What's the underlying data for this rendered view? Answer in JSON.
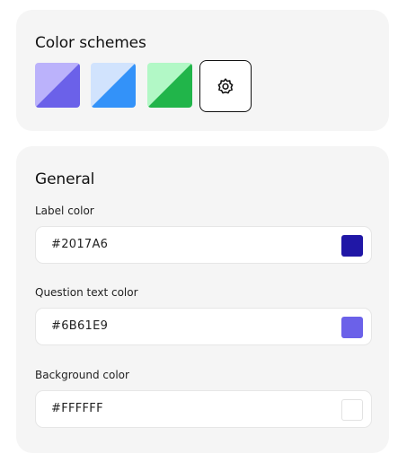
{
  "color_schemes": {
    "title": "Color schemes",
    "swatches": [
      {
        "name": "purple",
        "light": "#bbb2fb",
        "dark": "#6b61e9"
      },
      {
        "name": "blue",
        "light": "#d1e3fd",
        "dark": "#3392f9"
      },
      {
        "name": "green",
        "light": "#b2f8c6",
        "dark": "#21b54a"
      }
    ],
    "settings_icon": "gear-icon"
  },
  "general": {
    "title": "General",
    "fields": [
      {
        "label": "Label color",
        "value": "#2017A6",
        "swatch": "#2017a6"
      },
      {
        "label": "Question text color",
        "value": "#6B61E9",
        "swatch": "#6b61e9"
      },
      {
        "label": "Background color",
        "value": "#FFFFFF",
        "swatch": "#ffffff"
      }
    ]
  }
}
